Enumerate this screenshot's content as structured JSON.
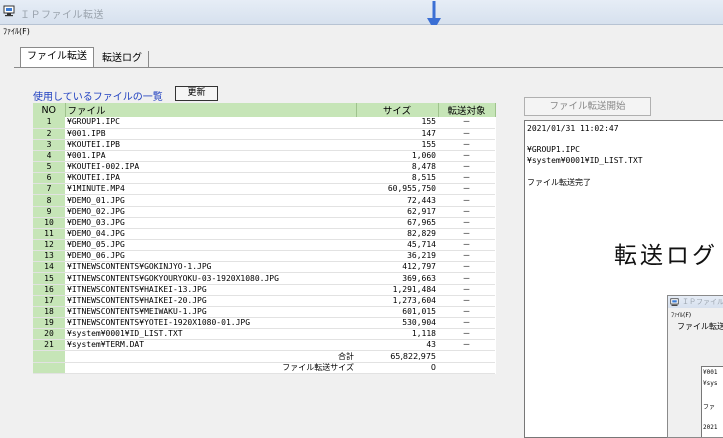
{
  "window": {
    "title": "ＩＰファイル転送"
  },
  "menu": {
    "file": "ﾌｧｲﾙ(F)"
  },
  "tabs": [
    {
      "label": "ファイル転送",
      "active": true
    },
    {
      "label": "転送ログ",
      "active": false
    }
  ],
  "file_list": {
    "heading": "使用しているファイルの一覧",
    "refresh_label": "更新",
    "columns": [
      "NO",
      "ファイル",
      "サイズ",
      "転送対象"
    ],
    "rows": [
      [
        "1",
        "¥GROUP1.IPC",
        "155",
        "－"
      ],
      [
        "2",
        "¥001.IPB",
        "147",
        "－"
      ],
      [
        "3",
        "¥KOUTEI.IPB",
        "155",
        "－"
      ],
      [
        "4",
        "¥001.IPA",
        "1,060",
        "－"
      ],
      [
        "5",
        "¥KOUTEI-002.IPA",
        "8,478",
        "－"
      ],
      [
        "6",
        "¥KOUTEI.IPA",
        "8,515",
        "－"
      ],
      [
        "7",
        "¥1MINUTE.MP4",
        "60,955,750",
        "－"
      ],
      [
        "8",
        "¥DEMO_01.JPG",
        "72,443",
        "－"
      ],
      [
        "9",
        "¥DEMO_02.JPG",
        "62,917",
        "－"
      ],
      [
        "10",
        "¥DEMO_03.JPG",
        "67,965",
        "－"
      ],
      [
        "11",
        "¥DEMO_04.JPG",
        "82,829",
        "－"
      ],
      [
        "12",
        "¥DEMO_05.JPG",
        "45,714",
        "－"
      ],
      [
        "13",
        "¥DEMO_06.JPG",
        "36,219",
        "－"
      ],
      [
        "14",
        "¥ITNEWSCONTENTS¥GOKINJYO-1.JPG",
        "412,797",
        "－"
      ],
      [
        "15",
        "¥ITNEWSCONTENTS¥GOKYOURYOKU-03-1920X1080.JPG",
        "369,663",
        "－"
      ],
      [
        "16",
        "¥ITNEWSCONTENTS¥HAIKEI-13.JPG",
        "1,291,484",
        "－"
      ],
      [
        "17",
        "¥ITNEWSCONTENTS¥HAIKEI-20.JPG",
        "1,273,604",
        "－"
      ],
      [
        "18",
        "¥ITNEWSCONTENTS¥MEIWAKU-1.JPG",
        "601,015",
        "－"
      ],
      [
        "19",
        "¥ITNEWSCONTENTS¥YOTEI-1920X1080-01.JPG",
        "530,904",
        "－"
      ],
      [
        "20",
        "¥system¥0001¥ID_LIST.TXT",
        "1,118",
        "－"
      ],
      [
        "21",
        "¥system¥TERM.DAT",
        "43",
        "－"
      ]
    ],
    "total_label": "合計",
    "total_value": "65,822,975",
    "transfer_size_label": "ファイル転送サイズ",
    "transfer_size_value": "0"
  },
  "transfer": {
    "start_label": "ファイル転送開始",
    "log_lines": [
      "2021/01/31 11:02:47",
      "",
      "¥GROUP1.IPC",
      "¥system¥0001¥ID_LIST.TXT",
      "",
      "ファイル転送完了"
    ]
  },
  "overlay": {
    "text": "転送ログ"
  },
  "mini_window": {
    "title": "ＩＰファイル転送",
    "menu": "ﾌｧｲﾙ(F)",
    "tab": "ファイル転送",
    "log_lines": [
      "¥001",
      "¥sys",
      "",
      "ファ",
      "",
      "2021"
    ]
  }
}
